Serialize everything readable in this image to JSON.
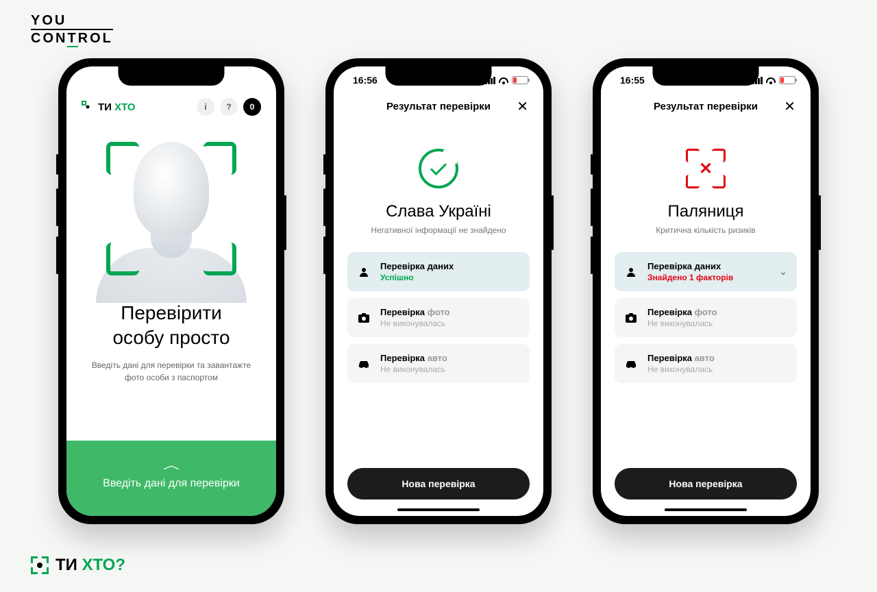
{
  "brand_top": {
    "line1": "YOU",
    "line2_pre": "CON",
    "line2_t": "T",
    "line2_post": "ROL"
  },
  "brand_bottom": {
    "part1": "ТИ",
    "part2": "ХТО?"
  },
  "phone1": {
    "logo": {
      "part1": "ТИ",
      "part2": "ХТО"
    },
    "icons": {
      "info": "i",
      "help": "?",
      "count": "0"
    },
    "title_line1": "Перевірити",
    "title_line2": "особу просто",
    "subtitle": "Введіть дані для перевірки та завантажте фото особи з паспортом",
    "cta": "Введіть дані для перевірки"
  },
  "phone2": {
    "time": "16:56",
    "header": "Результат перевірки",
    "title": "Слава Україні",
    "subtitle": "Негативної інформації не знайдено",
    "checks": [
      {
        "label": "Перевірка даних",
        "status": "Успішно",
        "status_class": "ok",
        "hl": true,
        "icon": "person"
      },
      {
        "label_a": "Перевірка",
        "label_b": "фото",
        "status": "Не виконувалась",
        "status_class": "na",
        "icon": "camera"
      },
      {
        "label_a": "Перевірка",
        "label_b": "авто",
        "status": "Не виконувалась",
        "status_class": "na",
        "icon": "car"
      }
    ],
    "button": "Нова перевірка"
  },
  "phone3": {
    "time": "16:55",
    "header": "Результат перевірки",
    "title": "Паляниця",
    "subtitle": "Критична кількість ризиків",
    "checks": [
      {
        "label": "Перевірка даних",
        "status": "Знайдено 1 факторів",
        "status_class": "err",
        "hl": true,
        "icon": "person",
        "expand": true
      },
      {
        "label_a": "Перевірка",
        "label_b": "фото",
        "status": "Не виконувалась",
        "status_class": "na",
        "icon": "camera"
      },
      {
        "label_a": "Перевірка",
        "label_b": "авто",
        "status": "Не виконувалась",
        "status_class": "na",
        "icon": "car"
      }
    ],
    "button": "Нова перевірка"
  }
}
